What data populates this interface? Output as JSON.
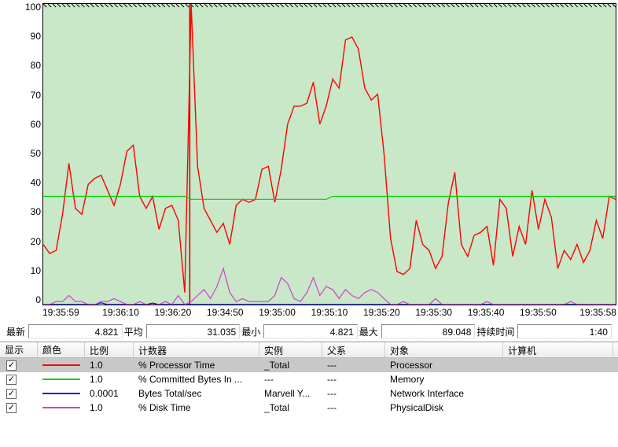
{
  "chart_data": {
    "type": "line",
    "ylim": [
      0,
      100
    ],
    "x_ticks": [
      "19:35:59",
      "19:36:10",
      "19:36:20",
      "19:34:50",
      "19:35:00",
      "19:35:10",
      "19:35:20",
      "19:35:30",
      "19:35:40",
      "19:35:50",
      "19:35:58"
    ],
    "y_ticks": [
      "100",
      "90",
      "80",
      "70",
      "60",
      "50",
      "40",
      "30",
      "20",
      "10",
      "0"
    ],
    "series": [
      {
        "name": "% Processor Time",
        "color": "#ff0000",
        "values": [
          20,
          17,
          18,
          30,
          47,
          32,
          30,
          40,
          42,
          43,
          38,
          33,
          40,
          51,
          53,
          36,
          32,
          36,
          25,
          32,
          33,
          28,
          4,
          100,
          46,
          32,
          28,
          24,
          27,
          20,
          33,
          35,
          34,
          35,
          45,
          46,
          34,
          45,
          60,
          66,
          66,
          67,
          74,
          60,
          66,
          75,
          72,
          88,
          89,
          85,
          72,
          68,
          70,
          50,
          22,
          11,
          10,
          12,
          28,
          20,
          18,
          12,
          16,
          34,
          44,
          20,
          16,
          23,
          24,
          26,
          13,
          35,
          32,
          16,
          26,
          20,
          38,
          25,
          35,
          29,
          12,
          18,
          15,
          20,
          14,
          18,
          28,
          22,
          36,
          35
        ]
      },
      {
        "name": "% Committed Bytes In Use",
        "color": "#00d000",
        "values": [
          36,
          36,
          36,
          36,
          36,
          36,
          36,
          36,
          36,
          36,
          36,
          36,
          36,
          36,
          36,
          36,
          36,
          36,
          36,
          36,
          36,
          36,
          36,
          35,
          35,
          35,
          35,
          35,
          35,
          35,
          35,
          35,
          35,
          35,
          35,
          35,
          35,
          35,
          35,
          35,
          35,
          35,
          35,
          35,
          35,
          36,
          36,
          36,
          36,
          36,
          36,
          36,
          36,
          36,
          36,
          36,
          36,
          36,
          36,
          36,
          36,
          36,
          36,
          36,
          36,
          36,
          36,
          36,
          36,
          36,
          36,
          36,
          36,
          36,
          36,
          36,
          36,
          36,
          36,
          36,
          36,
          36,
          36,
          36,
          36,
          36,
          36,
          36,
          36,
          36
        ]
      },
      {
        "name": "Bytes Total/sec",
        "color": "#0000ff",
        "values": [
          0,
          0,
          0,
          0,
          0,
          0,
          0,
          0,
          0,
          0.6,
          0,
          0,
          0,
          0,
          0,
          0,
          0,
          0.5,
          0,
          0,
          0,
          0,
          0,
          0,
          0,
          0,
          0,
          0,
          0,
          0,
          0,
          0,
          0,
          0,
          0,
          0,
          0,
          0,
          0,
          0,
          0,
          0,
          0,
          0,
          0,
          0,
          0,
          0,
          0,
          0,
          0,
          0,
          0,
          0,
          0,
          0,
          0,
          0,
          0,
          0,
          0,
          0,
          0,
          0,
          0,
          0,
          0,
          0,
          0,
          0,
          0,
          0,
          0,
          0,
          0,
          0,
          0,
          0,
          0,
          0,
          0,
          0,
          0,
          0,
          0,
          0,
          0,
          0,
          0,
          0
        ]
      },
      {
        "name": "% Disk Time",
        "color": "#d040d0",
        "values": [
          0,
          0,
          1,
          1,
          3,
          1,
          1,
          0,
          0,
          1,
          1,
          2,
          1,
          0,
          0,
          1,
          0,
          0,
          0,
          1,
          0,
          3,
          0,
          1,
          3,
          5,
          2,
          6,
          12,
          4,
          1,
          2,
          1,
          1,
          1,
          1,
          3,
          9,
          7,
          2,
          1,
          4,
          9,
          3,
          6,
          5,
          2,
          5,
          3,
          2,
          4,
          5,
          4,
          2,
          0,
          0,
          1,
          0,
          0,
          0,
          0,
          2,
          0,
          0,
          0,
          0,
          0,
          0,
          0,
          1,
          0,
          0,
          0,
          0,
          0,
          0,
          0,
          0,
          0,
          0,
          0,
          0,
          1,
          0,
          0,
          0,
          0,
          0,
          0,
          0
        ]
      }
    ]
  },
  "stats": {
    "labels": {
      "last": "最新",
      "avg": "平均",
      "min": "最小",
      "max": "最大",
      "duration": "持续时间"
    },
    "values": {
      "last": "4.821",
      "avg": "31.035",
      "min": "4.821",
      "max": "89.048",
      "duration": "1:40"
    }
  },
  "table": {
    "headers": {
      "show": "显示",
      "color": "颜色",
      "scale": "比例",
      "counter": "计数器",
      "instance": "实例",
      "parent": "父系",
      "object": "对象",
      "computer": "计算机"
    },
    "rows": [
      {
        "checked": true,
        "color": "#ff0000",
        "scale": "1.0",
        "counter": "% Processor Time",
        "instance": "_Total",
        "parent": "---",
        "object": "Processor",
        "computer": "",
        "selected": true
      },
      {
        "checked": true,
        "color": "#00d000",
        "scale": "1.0",
        "counter": "% Committed Bytes In ...",
        "instance": "---",
        "parent": "---",
        "object": "Memory",
        "computer": ""
      },
      {
        "checked": true,
        "color": "#0000ff",
        "scale": "0.0001",
        "counter": "Bytes Total/sec",
        "instance": "Marvell Y...",
        "parent": "---",
        "object": "Network Interface",
        "computer": ""
      },
      {
        "checked": true,
        "color": "#d040d0",
        "scale": "1.0",
        "counter": "% Disk Time",
        "instance": "_Total",
        "parent": "---",
        "object": "PhysicalDisk",
        "computer": ""
      }
    ]
  }
}
